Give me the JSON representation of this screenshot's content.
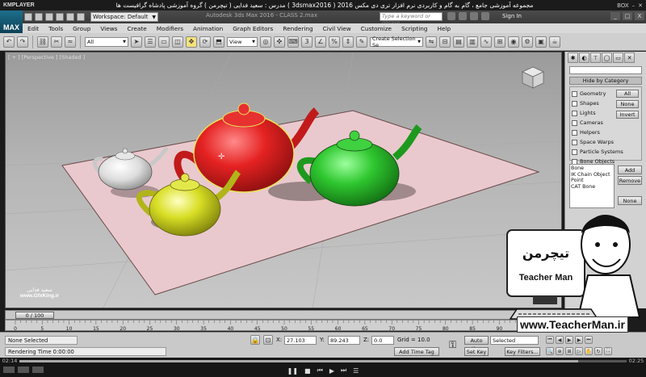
{
  "player": {
    "logo": "KMPLAYER",
    "title": "مجموعه آموزشی جامع ، گام به گام و کاربردی نرم افزار تری دی مکس 2016  ( 3dsmax2016 )  مدرس : سعید فدایی ( تیچرمن ) گروه آموزشی پادشاه گرافیست ها",
    "right_label": "BOX",
    "time_elapsed": "02:14",
    "time_total": "02:25",
    "progress": 0.92
  },
  "max": {
    "logo": "MAX",
    "workspace": "Workspace: Default",
    "doc_title": "Autodesk 3ds Max 2016 - CLASS 2.max",
    "search_placeholder": "Type a keyword or phrase",
    "sign_in": "Sign In",
    "window_controls": [
      "_",
      "□",
      "X"
    ]
  },
  "menu": [
    "Edit",
    "Tools",
    "Group",
    "Views",
    "Create",
    "Modifiers",
    "Animation",
    "Graph Editors",
    "Rendering",
    "Civil View",
    "Customize",
    "Scripting",
    "Help"
  ],
  "toolbar": {
    "filter": "All",
    "coord_system": "View",
    "selection_set": "Create Selection Se"
  },
  "viewport": {
    "label": "[ + ] [Perspective ] [Shaded ]",
    "watermark_name": "سعید فدایی",
    "watermark_site": "www.GfxKing.ir"
  },
  "command_panel": {
    "rollout_title": "Hide by Category",
    "categories": [
      "Geometry",
      "Shapes",
      "Lights",
      "Cameras",
      "Helpers",
      "Space Warps",
      "Particle Systems",
      "Bone Objects"
    ],
    "btn_all": "All",
    "btn_none": "None",
    "btn_invert": "Invert",
    "list_items": [
      "Bone",
      "IK Chain Object",
      "Point",
      "CAT Bone"
    ],
    "btn_add": "Add",
    "btn_remove": "Remove",
    "btn_none2": "None"
  },
  "teacher": {
    "brand_fa": "تیچرمن",
    "brand_en": "Teacher Man",
    "site": "www.TeacherMan.ir"
  },
  "timeline": {
    "frame_label": "0 / 100",
    "ticks": [
      "0",
      "5",
      "10",
      "15",
      "20",
      "25",
      "30",
      "35",
      "40",
      "45",
      "50",
      "55",
      "60",
      "65",
      "70",
      "75",
      "80",
      "85",
      "90",
      "95",
      "100"
    ]
  },
  "status": {
    "selection": "None Selected",
    "prompt": "Rendering Time  0:00:00",
    "x_label": "X:",
    "x_value": "27.103",
    "y_label": "Y:",
    "y_value": "89.243",
    "z_label": "Z:",
    "z_value": "0.0",
    "grid": "Grid = 10.0",
    "add_time_tag": "Add Time Tag",
    "auto_key": "Auto Key",
    "set_key": "Set Key",
    "key_mode": "Selected",
    "key_filters": "Key Filters..."
  }
}
